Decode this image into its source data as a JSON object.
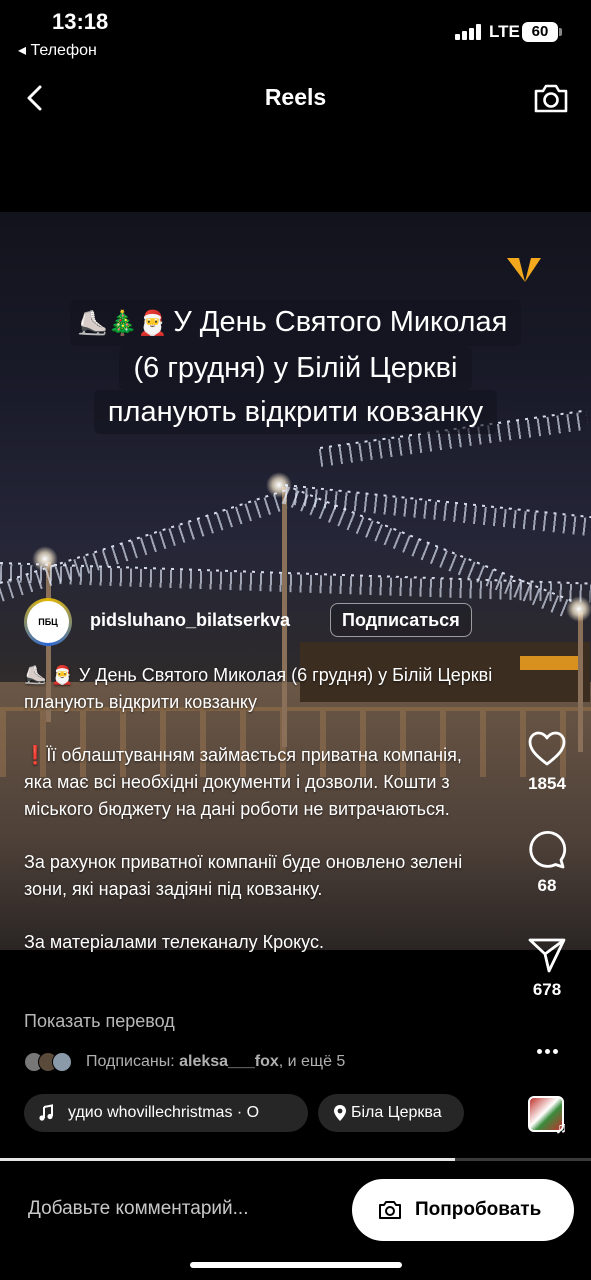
{
  "status_bar": {
    "time": "13:18",
    "back_app": "◂ Телефон",
    "network": "LTE",
    "battery": "60"
  },
  "header": {
    "title": "Reels"
  },
  "video": {
    "caption_lines": [
      "У День Святого Миколая",
      "(6 грудня) у Білій Церкві",
      "планують відкрити ковзанку"
    ],
    "caption_emoji": "⛸️🎄🎅"
  },
  "author": {
    "avatar_text": "ПБЦ",
    "username": "pidsluhano_bilatserkva",
    "subscribe_label": "Подписаться"
  },
  "description": {
    "paragraphs": [
      "⛸️ 🎅 У День Святого Миколая (6 грудня) у Білій Церкві планують відкрити ковзанку",
      "❗Її облаштуванням займається приватна компанія, яка має всі необхідні документи і дозволи. Кошти з міського бюджету на дані роботи не витрачаються.",
      "За рахунок приватної компанії буде оновлено зелені зони, які наразі задіяні під ковзанку.",
      "За матеріалами телеканалу Крокус."
    ],
    "translate_link": "Показать перевод"
  },
  "followed_by": {
    "prefix": "Подписаны: ",
    "user": "aleksa___fox",
    "suffix": ", и ещё 5"
  },
  "chips": {
    "audio": "удио    whovillechristmas · О",
    "location": "Біла Церква"
  },
  "actions": {
    "likes": "1854",
    "comments": "68",
    "shares": "678"
  },
  "progress": {
    "fraction": 0.77
  },
  "bottom": {
    "comment_placeholder": "Добавьте комментарий...",
    "try_label": "Попробовать"
  },
  "colors": {
    "background": "#000000",
    "chip_bg": "#262626",
    "secondary_text": "#b8b8b8"
  }
}
